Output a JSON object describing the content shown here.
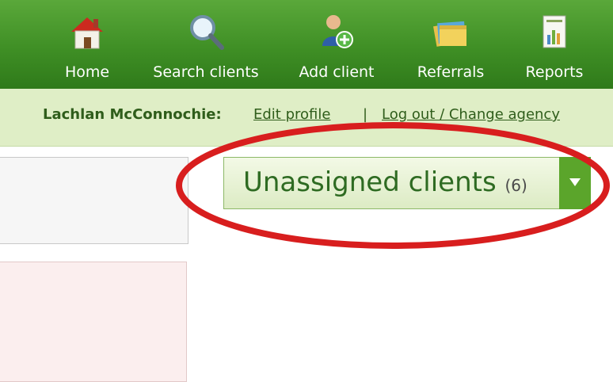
{
  "nav": {
    "items": [
      {
        "label": "Home",
        "icon": "home-icon"
      },
      {
        "label": "Search clients",
        "icon": "search-icon"
      },
      {
        "label": "Add client",
        "icon": "add-user-icon"
      },
      {
        "label": "Referrals",
        "icon": "folders-icon"
      },
      {
        "label": "Reports",
        "icon": "report-icon"
      }
    ]
  },
  "userbar": {
    "name": "Lachlan McConnochie:",
    "edit_profile": "Edit profile",
    "separator": "|",
    "logout": "Log out / Change agency"
  },
  "unassigned": {
    "title": "Unassigned clients",
    "count": "(6)"
  },
  "colors": {
    "nav_green": "#3f8f25",
    "userbar_bg": "#dfeec6",
    "annotation_red": "#d81e1e"
  }
}
